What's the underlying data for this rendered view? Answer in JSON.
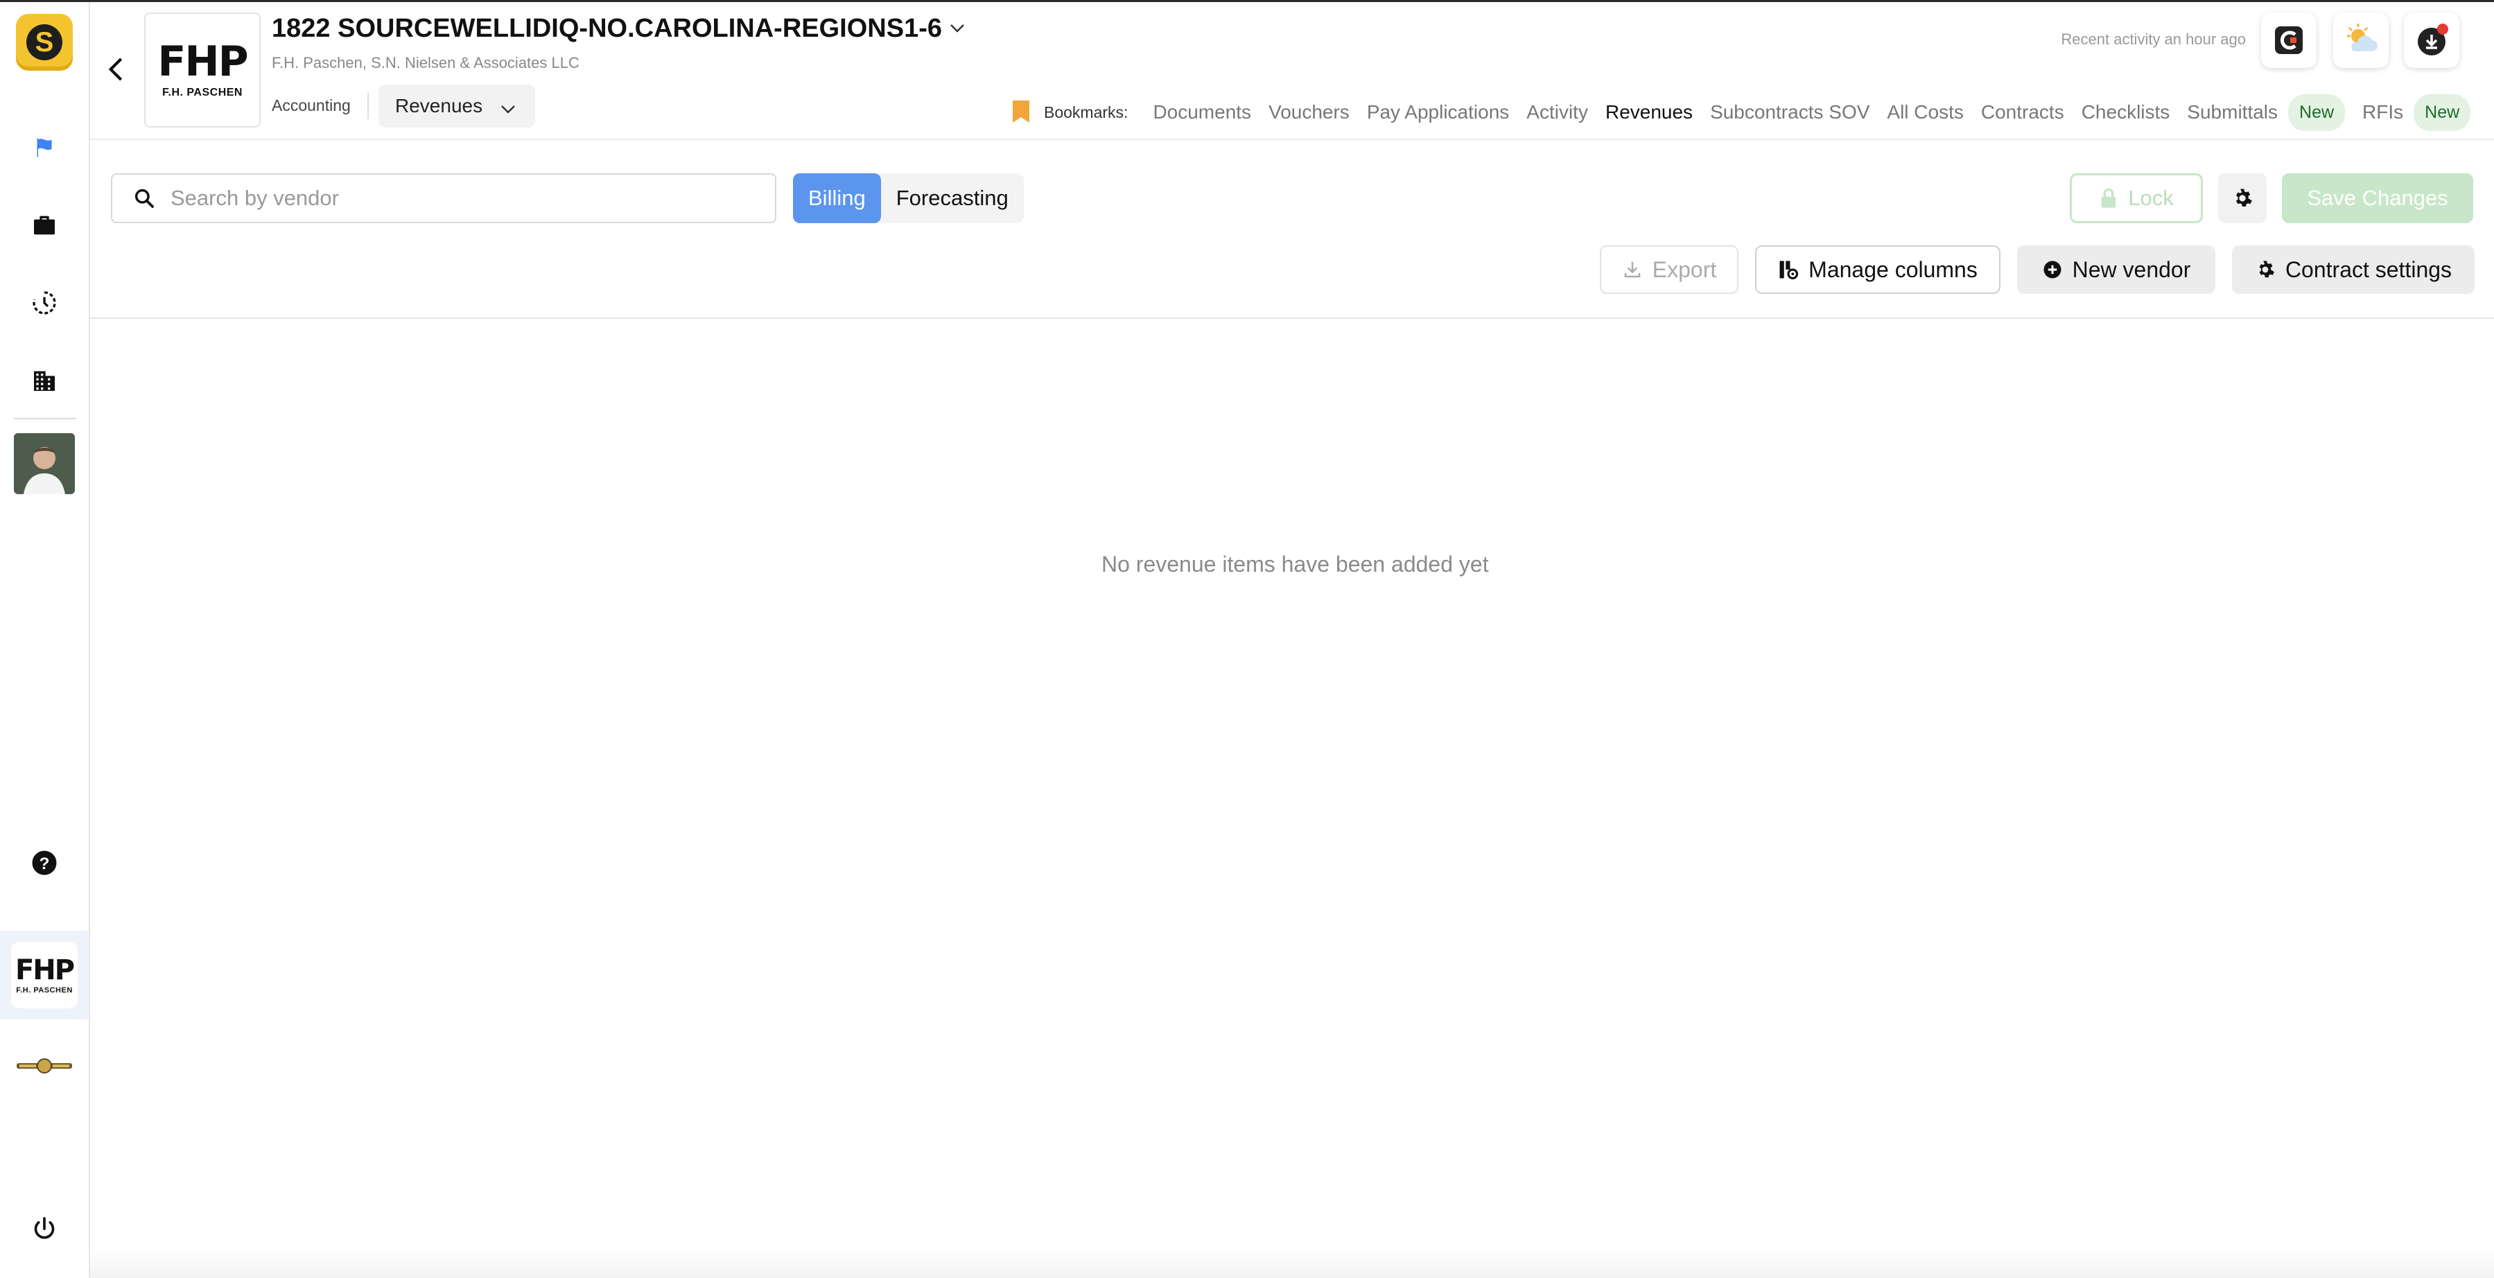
{
  "app": {
    "logo_letter": "S",
    "accent": "#5b95ee",
    "brand_yellow": "#f4c430"
  },
  "sidebar": {
    "items": [
      {
        "icon": "flag-icon"
      },
      {
        "icon": "briefcase-icon"
      },
      {
        "icon": "history-icon"
      },
      {
        "icon": "building-icon"
      }
    ],
    "company_tile": {
      "logo_text": "FHP",
      "logo_sub": "F.H. PASCHEN"
    }
  },
  "header": {
    "project_title": "1822 SOURCEWELLIDIQ-NO.CAROLINA-REGIONS1-6",
    "project_subtitle": "F.H. Paschen, S.N. Nielsen & Associates LLC",
    "logo_text": "FHP",
    "logo_sub": "F.H. PASCHEN",
    "breadcrumb_section": "Accounting",
    "module_selected": "Revenues",
    "recent_activity": "Recent activity an hour ago"
  },
  "nav": {
    "bookmarks_label": "Bookmarks:",
    "items": [
      {
        "label": "Documents"
      },
      {
        "label": "Vouchers"
      },
      {
        "label": "Pay Applications"
      },
      {
        "label": "Activity"
      },
      {
        "label": "Revenues",
        "active": true
      },
      {
        "label": "Subcontracts SOV"
      },
      {
        "label": "All Costs"
      },
      {
        "label": "Contracts"
      },
      {
        "label": "Checklists"
      },
      {
        "label": "Submittals",
        "badge": "New"
      },
      {
        "label": "RFIs",
        "badge": "New"
      }
    ]
  },
  "toolbar": {
    "search_placeholder": "Search by vendor",
    "segments": [
      "Billing",
      "Forecasting"
    ],
    "segment_selected": "Billing",
    "lock_label": "Lock",
    "save_label": "Save Changes",
    "export_label": "Export",
    "manage_columns_label": "Manage columns",
    "new_vendor_label": "New vendor",
    "contract_settings_label": "Contract settings"
  },
  "main": {
    "empty_message": "No revenue items have been added yet"
  }
}
